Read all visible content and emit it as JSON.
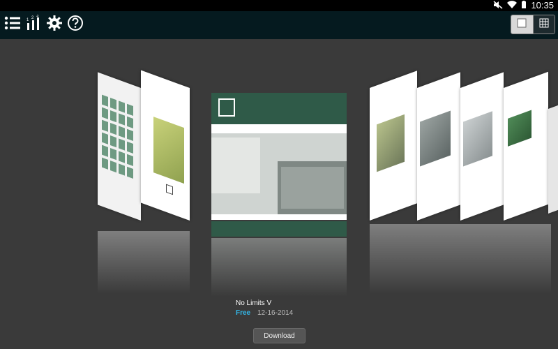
{
  "status_bar": {
    "time": "10:35",
    "icons": [
      "mute-icon",
      "wifi-icon",
      "battery-icon"
    ]
  },
  "toolbar": {
    "buttons": [
      {
        "name": "list-icon"
      },
      {
        "name": "chart-icon"
      },
      {
        "name": "settings-icon"
      },
      {
        "name": "help-icon"
      }
    ],
    "view_modes": [
      {
        "name": "single-view-icon",
        "selected": true
      },
      {
        "name": "grid-view-icon",
        "selected": false
      }
    ]
  },
  "selected_item": {
    "title": "No Limits V",
    "price": "Free",
    "date": "12-16-2014",
    "download_label": "Download"
  },
  "colors": {
    "toolbar_bg": "#051a1f",
    "background": "#3a3a3a",
    "cover_green": "#2f5a48",
    "accent": "#33b5e5"
  }
}
